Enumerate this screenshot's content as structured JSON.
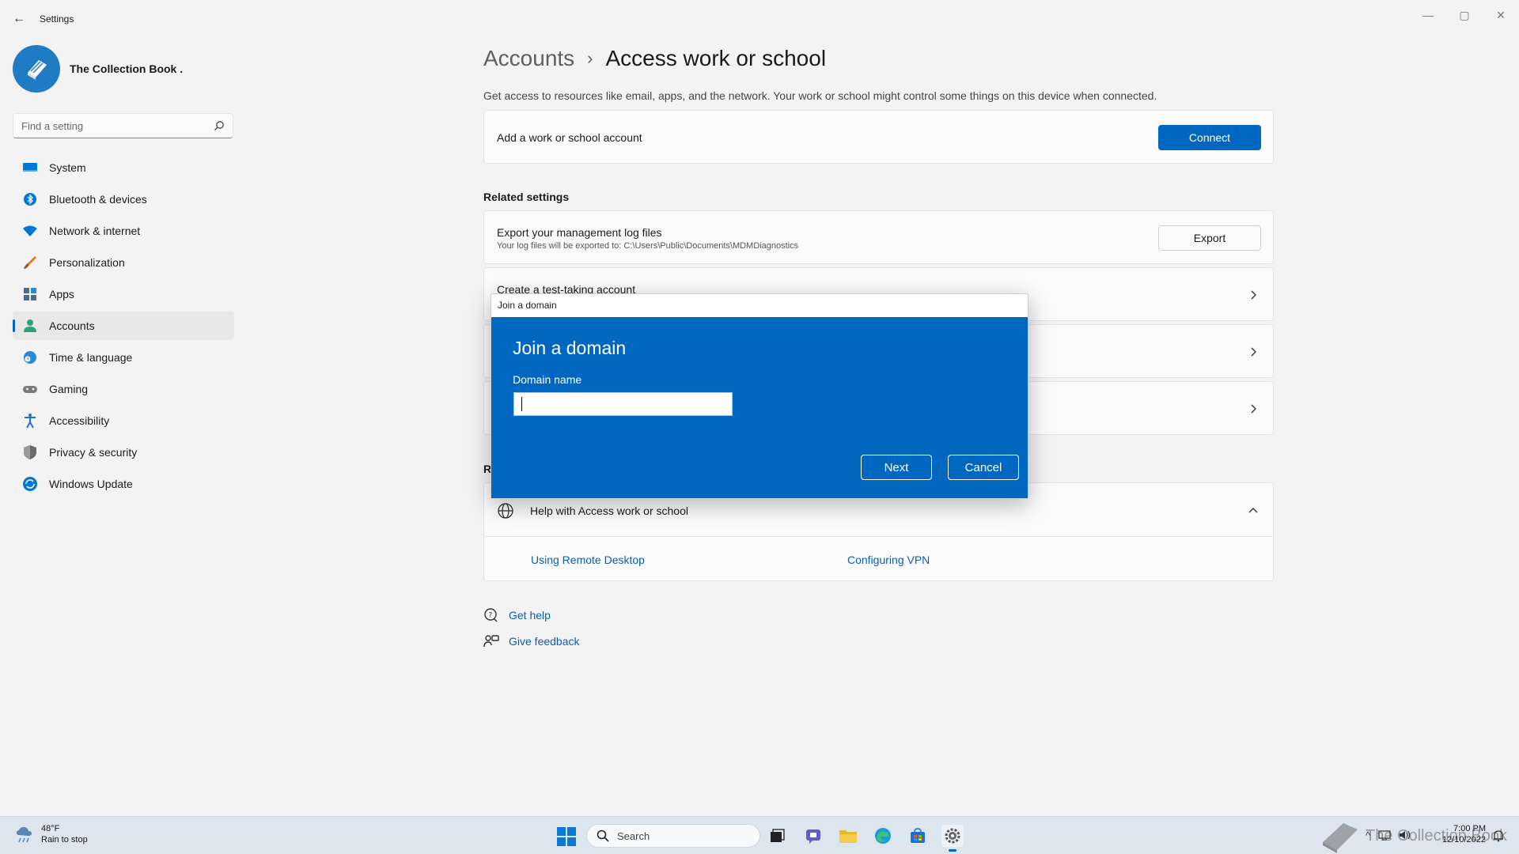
{
  "app": {
    "title": "Settings",
    "back_glyph": "←",
    "minimize_glyph": "—",
    "maximize_glyph": "▢",
    "close_glyph": "✕"
  },
  "profile": {
    "name": "The Collection Book ."
  },
  "search": {
    "placeholder": "Find a setting"
  },
  "nav": {
    "items": [
      {
        "label": "System",
        "icon": "monitor-icon",
        "color": "#0078d4"
      },
      {
        "label": "Bluetooth & devices",
        "icon": "bluetooth-icon",
        "color": "#0078d4"
      },
      {
        "label": "Network & internet",
        "icon": "wifi-icon",
        "color": "#0078d4"
      },
      {
        "label": "Personalization",
        "icon": "brush-icon",
        "color": "#e07b2a"
      },
      {
        "label": "Apps",
        "icon": "apps-icon",
        "color": "#4a6b8a"
      },
      {
        "label": "Accounts",
        "icon": "person-icon",
        "color": "#2aa57b",
        "active": true
      },
      {
        "label": "Time & language",
        "icon": "clock-globe-icon",
        "color": "#2b88d8"
      },
      {
        "label": "Gaming",
        "icon": "gamepad-icon",
        "color": "#7a7a7a"
      },
      {
        "label": "Accessibility",
        "icon": "accessibility-icon",
        "color": "#1f6fd1"
      },
      {
        "label": "Privacy & security",
        "icon": "shield-icon",
        "color": "#6b6b6b"
      },
      {
        "label": "Windows Update",
        "icon": "update-icon",
        "color": "#0078d4"
      }
    ]
  },
  "main": {
    "breadcrumb_parent": "Accounts",
    "breadcrumb_sep": "›",
    "title": "Access work or school",
    "description": "Get access to resources like email, apps, and the network. Your work or school might control some things on this device when connected.",
    "add_account": {
      "label": "Add a work or school account",
      "button": "Connect"
    },
    "related_title": "Related settings",
    "export": {
      "title": "Export your management log files",
      "subtitle": "Your log files will be exported to: C:\\Users\\Public\\Documents\\MDMDiagnostics",
      "button": "Export"
    },
    "test_account": {
      "title": "Create a test-taking account"
    },
    "related_support_partial": "R",
    "help": {
      "title": "Help with Access work or school",
      "links": [
        "Using Remote Desktop",
        "Configuring VPN"
      ]
    },
    "footer": {
      "get_help": "Get help",
      "give_feedback": "Give feedback"
    }
  },
  "dialog": {
    "window_title": "Join a domain",
    "heading": "Join a domain",
    "field_label": "Domain name",
    "field_value": "",
    "next": "Next",
    "cancel": "Cancel"
  },
  "taskbar": {
    "weather_temp": "48°F",
    "weather_desc": "Rain to stop",
    "search_label": "Search",
    "watermark": "The Collection Book",
    "time": "7:00 PM",
    "date": "12/10/2022",
    "accent": "#0067c0"
  }
}
